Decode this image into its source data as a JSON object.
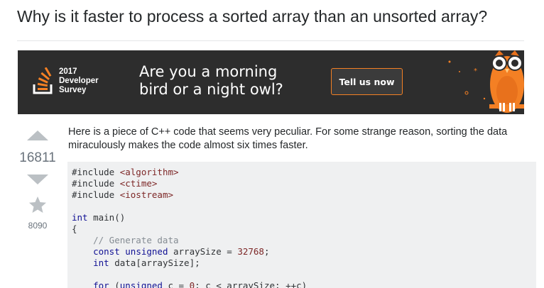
{
  "question": {
    "title": "Why is it faster to process a sorted array than an unsorted array?"
  },
  "banner": {
    "survey_line1": "2017",
    "survey_line2": "Developer",
    "survey_line3": "Survey",
    "headline_line1": "Are you a morning",
    "headline_line2": "bird or a night owl?",
    "cta_label": "Tell us now",
    "colors": {
      "background": "#2d2d2d",
      "accent": "#f48024"
    }
  },
  "votes": {
    "score": "16811",
    "favorites": "8090"
  },
  "post": {
    "body": "Here is a piece of C++ code that seems very peculiar. For some strange reason, sorting the data miraculously makes the code almost six times faster."
  },
  "code": {
    "lines": [
      [
        [
          "pp",
          "#include "
        ],
        [
          "str",
          "<algorithm>"
        ]
      ],
      [
        [
          "pp",
          "#include "
        ],
        [
          "str",
          "<ctime>"
        ]
      ],
      [
        [
          "pp",
          "#include "
        ],
        [
          "str",
          "<iostream>"
        ]
      ],
      [],
      [
        [
          "kw",
          "int"
        ],
        [
          "pp",
          " main()"
        ]
      ],
      [
        [
          "pp",
          "{"
        ]
      ],
      [
        [
          "com",
          "    // Generate data"
        ]
      ],
      [
        [
          "pp",
          "    "
        ],
        [
          "kw",
          "const unsigned"
        ],
        [
          "pp",
          " arraySize = "
        ],
        [
          "num",
          "32768"
        ],
        [
          "pp",
          ";"
        ]
      ],
      [
        [
          "pp",
          "    "
        ],
        [
          "kw",
          "int"
        ],
        [
          "pp",
          " data[arraySize];"
        ]
      ],
      [],
      [
        [
          "pp",
          "    "
        ],
        [
          "kw",
          "for"
        ],
        [
          "pp",
          " ("
        ],
        [
          "kw",
          "unsigned"
        ],
        [
          "pp",
          " c = "
        ],
        [
          "num",
          "0"
        ],
        [
          "pp",
          "; c < arraySize; ++c)"
        ]
      ]
    ]
  }
}
